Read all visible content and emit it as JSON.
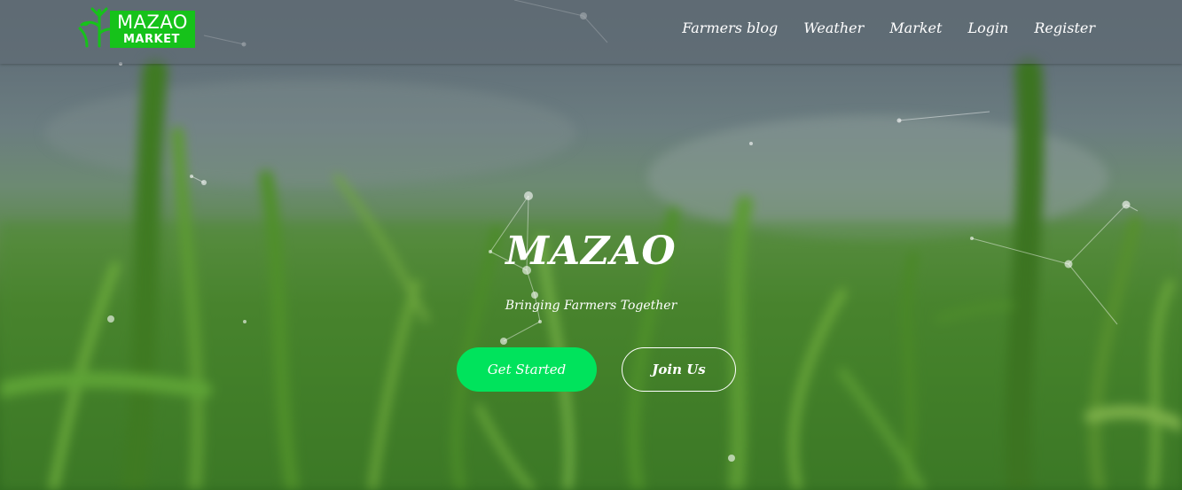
{
  "logo": {
    "line1": "MAZAO",
    "line2": "MARKET",
    "icon": "sprout-icon",
    "brand_color": "#16c21a"
  },
  "nav": {
    "items": [
      {
        "label": "Farmers blog"
      },
      {
        "label": "Weather"
      },
      {
        "label": "Market"
      },
      {
        "label": "Login"
      },
      {
        "label": "Register"
      }
    ]
  },
  "hero": {
    "title": "MAZAO",
    "subtitle": "Bringing Farmers Together",
    "primary_button": "Get Started",
    "secondary_button": "Join Us",
    "primary_color": "#00e35c",
    "background": "green wheat field"
  }
}
